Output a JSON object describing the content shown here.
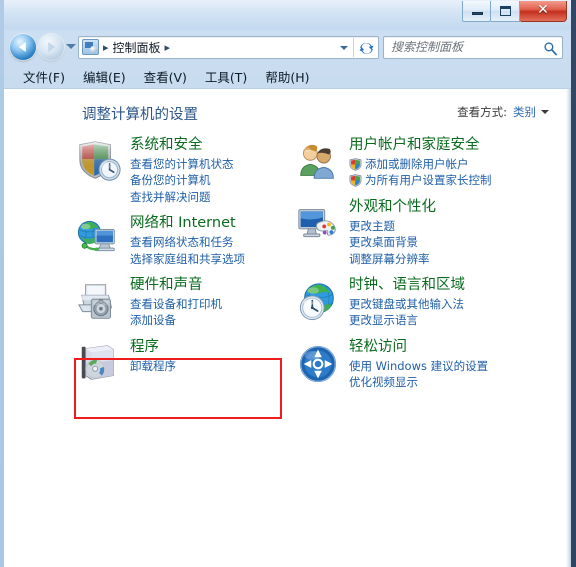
{
  "window": {
    "caption": {
      "minimize_label": "—",
      "maximize_label": "□",
      "close_label": "✕"
    }
  },
  "addressbar": {
    "icon": "control-panel-icon",
    "separator": "▸",
    "crumbs": [
      "控制面板"
    ],
    "dropdown": "▾",
    "refresh": "refresh-icon"
  },
  "search": {
    "placeholder": "搜索控制面板",
    "value": "",
    "icon": "search-icon"
  },
  "menubar": {
    "items": [
      {
        "label": "文件(F)"
      },
      {
        "label": "编辑(E)"
      },
      {
        "label": "查看(V)"
      },
      {
        "label": "工具(T)"
      },
      {
        "label": "帮助(H)"
      }
    ]
  },
  "header": {
    "title": "调整计算机的设置",
    "view_by_label": "查看方式:",
    "view_by_value": "类别"
  },
  "categories": {
    "left": [
      {
        "title": "系统和安全",
        "icon": "shield-clock-icon",
        "links": [
          {
            "text": "查看您的计算机状态",
            "shield": false
          },
          {
            "text": "备份您的计算机",
            "shield": false
          },
          {
            "text": "查找并解决问题",
            "shield": false
          }
        ]
      },
      {
        "title": "网络和 Internet",
        "icon": "network-globe-icon",
        "highlighted": true,
        "links": [
          {
            "text": "查看网络状态和任务",
            "shield": false
          },
          {
            "text": "选择家庭组和共享选项",
            "shield": false
          }
        ]
      },
      {
        "title": "硬件和声音",
        "icon": "printer-speaker-icon",
        "links": [
          {
            "text": "查看设备和打印机",
            "shield": false
          },
          {
            "text": "添加设备",
            "shield": false
          }
        ]
      },
      {
        "title": "程序",
        "icon": "programs-box-icon",
        "links": [
          {
            "text": "卸载程序",
            "shield": false
          }
        ]
      }
    ],
    "right": [
      {
        "title": "用户帐户和家庭安全",
        "icon": "users-icon",
        "links": [
          {
            "text": "添加或删除用户帐户",
            "shield": true
          },
          {
            "text": "为所有用户设置家长控制",
            "shield": true
          }
        ]
      },
      {
        "title": "外观和个性化",
        "icon": "monitor-palette-icon",
        "links": [
          {
            "text": "更改主题",
            "shield": false
          },
          {
            "text": "更改桌面背景",
            "shield": false
          },
          {
            "text": "调整屏幕分辨率",
            "shield": false
          }
        ]
      },
      {
        "title": "时钟、语言和区域",
        "icon": "globe-clock-icon",
        "links": [
          {
            "text": "更改键盘或其他输入法",
            "shield": false
          },
          {
            "text": "更改显示语言",
            "shield": false
          }
        ]
      },
      {
        "title": "轻松访问",
        "icon": "ease-of-access-icon",
        "links": [
          {
            "text": "使用 Windows 建议的设置",
            "shield": false
          },
          {
            "text": "优化视频显示",
            "shield": false
          }
        ]
      }
    ]
  },
  "annotation": {
    "highlight_color": "#ee1c1c",
    "highlight_target": "网络和 Internet"
  }
}
